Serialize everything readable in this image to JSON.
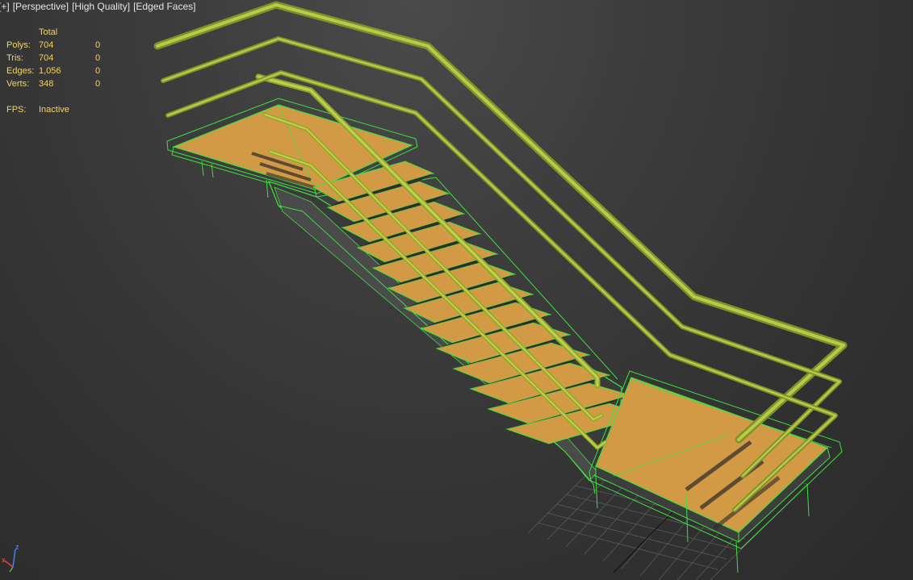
{
  "viewport": {
    "label_plus": "[+]",
    "label_view": "[Perspective]",
    "label_shading": "[High Quality]",
    "label_edges": "[Edged Faces]"
  },
  "stats": {
    "header_total": "Total",
    "rows": [
      {
        "label": "Polys:",
        "total": "704",
        "selected": "0"
      },
      {
        "label": "Tris:",
        "total": "704",
        "selected": "0"
      },
      {
        "label": "Edges:",
        "total": "1,056",
        "selected": "0"
      },
      {
        "label": "Verts:",
        "total": "348",
        "selected": "0"
      }
    ],
    "fps_label": "FPS:",
    "fps_value": "Inactive"
  },
  "gizmo": {
    "x": "x",
    "z": "z"
  },
  "colors": {
    "background": "#3a3a3a",
    "wireframe": "#3fe03f",
    "rail": "#a6b833",
    "tread": "#d39a45",
    "stats_text": "#f2d66b"
  }
}
